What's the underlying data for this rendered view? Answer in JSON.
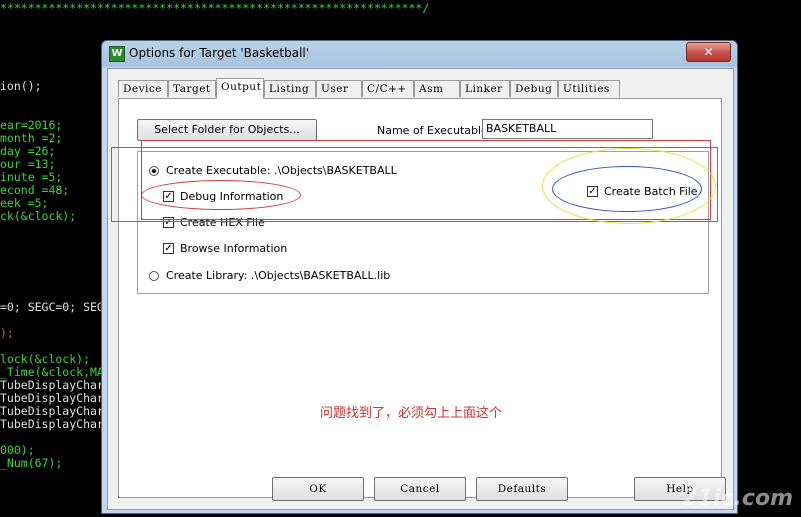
{
  "window": {
    "title": "Options for Target 'Basketball'",
    "app_icon_letter": "W",
    "close_glyph": "✕"
  },
  "tabs": [
    {
      "label": "Device",
      "active": false
    },
    {
      "label": "Target",
      "active": false
    },
    {
      "label": "Output",
      "active": true
    },
    {
      "label": "Listing",
      "active": false
    },
    {
      "label": "User",
      "active": false
    },
    {
      "label": "C/C++",
      "active": false
    },
    {
      "label": "Asm",
      "active": false
    },
    {
      "label": "Linker",
      "active": false
    },
    {
      "label": "Debug",
      "active": false
    },
    {
      "label": "Utilities",
      "active": false
    }
  ],
  "output": {
    "select_folder_label": "Select Folder for Objects...",
    "name_of_exe_label": "Name of Executable:",
    "name_of_exe_value": "BASKETBALL",
    "create_executable_label": "Create Executable:  .\\Objects\\BASKETBALL",
    "create_executable_selected": true,
    "debug_info_label": "Debug Information",
    "debug_info_checked": true,
    "create_hex_label": "Create HEX File",
    "create_hex_checked": true,
    "browse_info_label": "Browse Information",
    "browse_info_checked": true,
    "create_library_label": "Create Library:  .\\Objects\\BASKETBALL.lib",
    "create_library_selected": false,
    "create_batch_label": "Create Batch File",
    "create_batch_checked": true
  },
  "annotation_note": "问题找到了，必须勾上上面这个",
  "footer": {
    "ok": "OK",
    "cancel": "Cancel",
    "defaults": "Defaults",
    "help": "Help"
  },
  "watermark": "21ic.com",
  "background_code": {
    "top_line": "*************************************************************/",
    "lines": [
      {
        "text": "ion();",
        "color": "#e0e0e0"
      },
      {
        "text": "ear=2016;",
        "color": "#39d739"
      },
      {
        "text": "month =2;",
        "color": "#39d739"
      },
      {
        "text": "day =26;",
        "color": "#39d739"
      },
      {
        "text": "our =13;",
        "color": "#39d739"
      },
      {
        "text": "inute =5;",
        "color": "#39d739"
      },
      {
        "text": "econd =48;",
        "color": "#39d739"
      },
      {
        "text": "eek =5;",
        "color": "#39d739"
      },
      {
        "text": "ck(&clock);",
        "color": "#39d739"
      },
      {
        "text": "=0; SEGC=0; SEG",
        "color": "#e0e0e0"
      },
      {
        "text": ");",
        "color": "#e05050"
      },
      {
        "text": "lock(&clock);",
        "color": "#39d739"
      },
      {
        "text": "_Time(&clock,MA",
        "color": "#39d739"
      },
      {
        "text": "TubeDisplayChar",
        "color": "#e0e0e0"
      },
      {
        "text": "TubeDisplayChar",
        "color": "#e0e0e0"
      },
      {
        "text": "TubeDisplayChar",
        "color": "#e0e0e0"
      },
      {
        "text": "TubeDisplayChar",
        "color": "#e0e0e0"
      },
      {
        "text": "000);",
        "color": "#39d739"
      },
      {
        "text": "_Num(67);",
        "color": "#39d739"
      }
    ]
  }
}
